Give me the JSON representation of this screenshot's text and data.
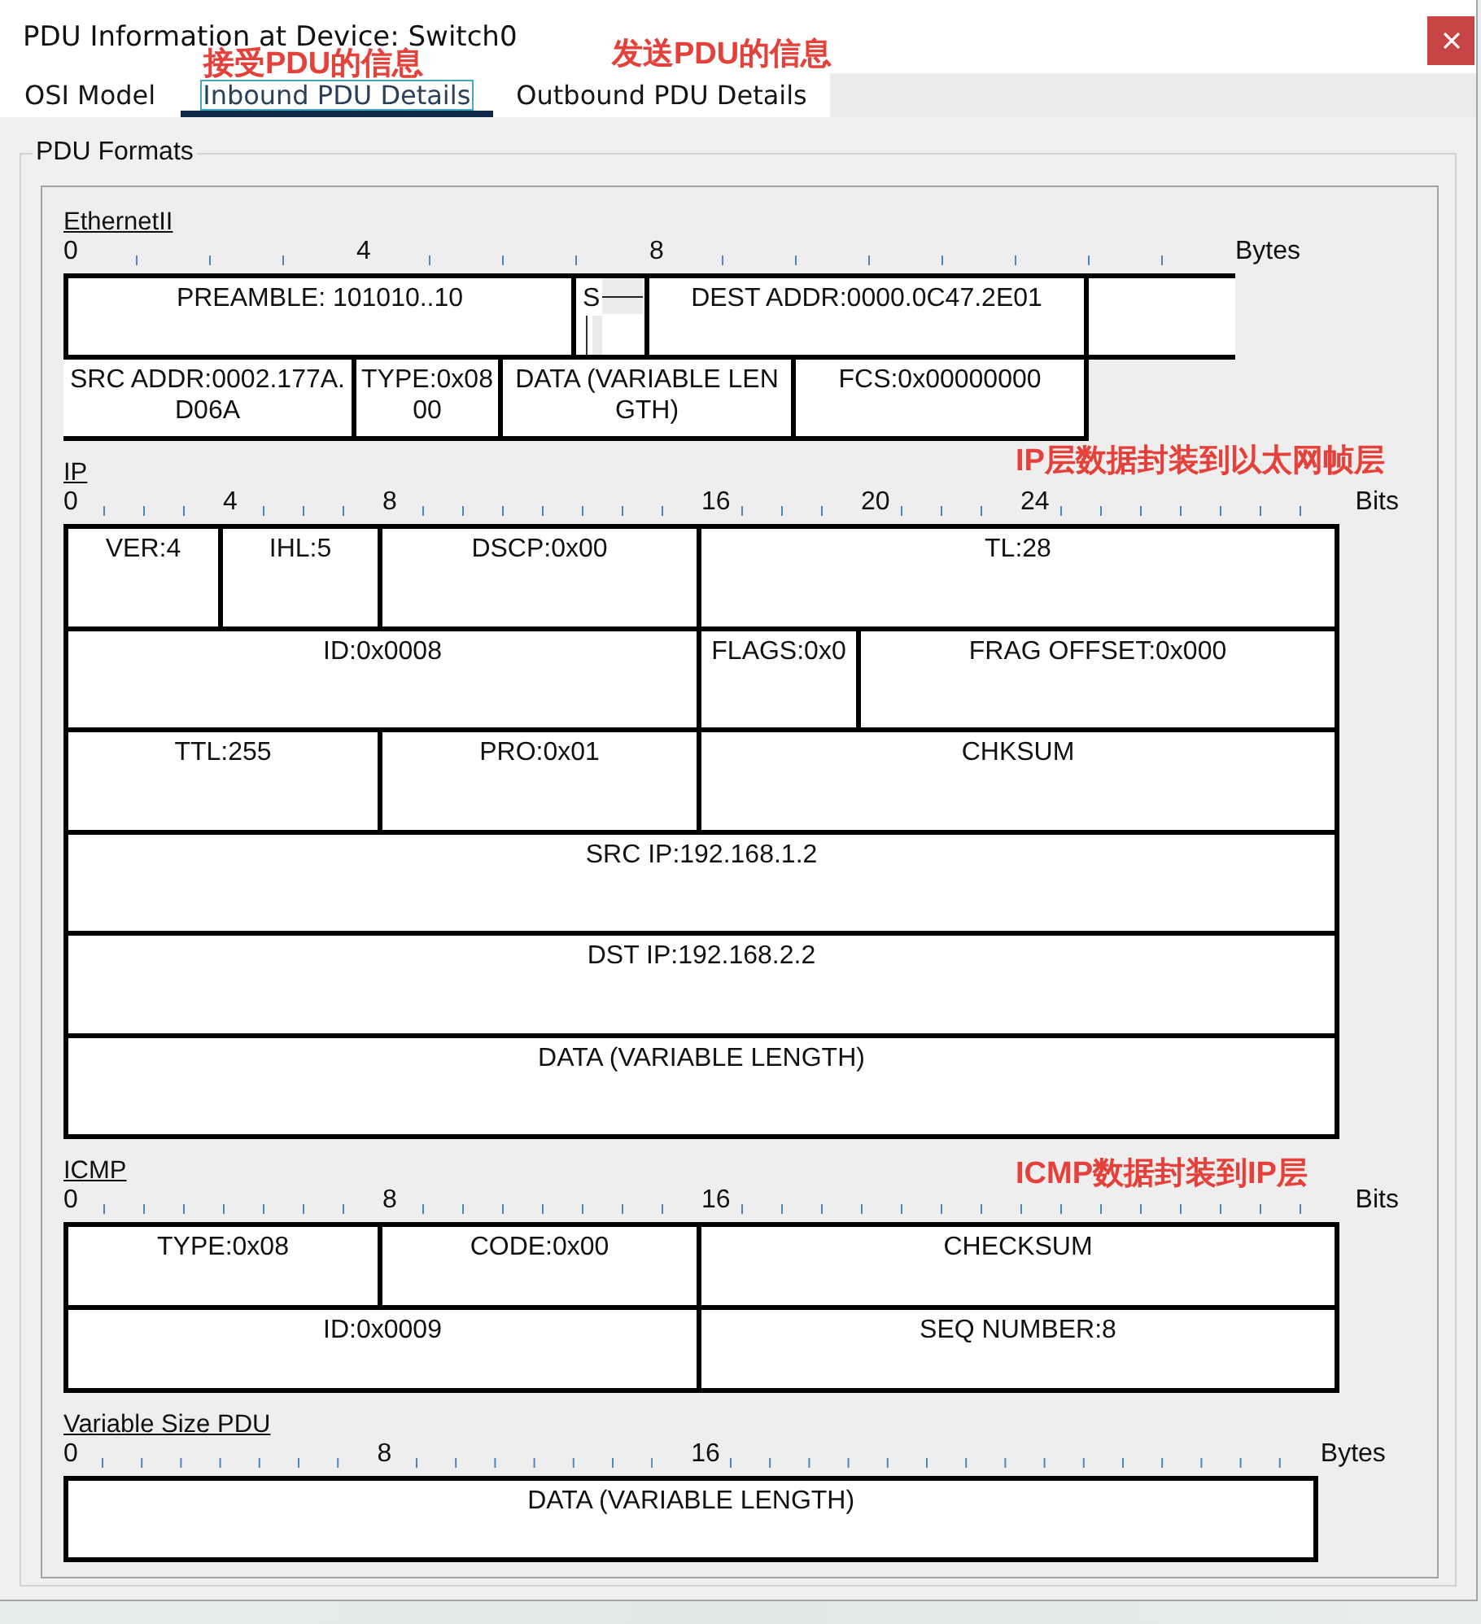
{
  "window": {
    "title": "PDU Information at Device: Switch0"
  },
  "tabs": [
    {
      "label": "OSI Model",
      "selected": false
    },
    {
      "label": "Inbound PDU Details",
      "selected": true
    },
    {
      "label": "Outbound PDU Details",
      "selected": false
    }
  ],
  "group": {
    "title": "PDU Formats"
  },
  "sections": [
    {
      "title": "EthernetII",
      "ruler": {
        "labels": [
          "0",
          "4",
          "8"
        ],
        "unit": "Bytes"
      },
      "fields": [
        {
          "kind": "text",
          "text": "PREAMBLE: 101010..10"
        },
        {
          "kind": "split",
          "text": "S"
        },
        {
          "kind": "text",
          "text": "DEST ADDR:0000.0C47.2E01"
        },
        {
          "kind": "blank"
        },
        {
          "kind": "text",
          "text": "SRC ADDR:0002.177A.\nD06A"
        },
        {
          "kind": "text",
          "text": "TYPE:0x08\n00"
        },
        {
          "kind": "text",
          "text": "DATA (VARIABLE LEN\nGTH)"
        },
        {
          "kind": "text",
          "text": "FCS:0x00000000"
        }
      ]
    },
    {
      "title": "IP",
      "ruler": {
        "labels": [
          "0",
          "4",
          "8",
          "16",
          "20",
          "24"
        ],
        "unit": "Bits"
      },
      "fields": [
        {
          "kind": "text",
          "text": "VER:4"
        },
        {
          "kind": "text",
          "text": "IHL:5"
        },
        {
          "kind": "text",
          "text": "DSCP:0x00"
        },
        {
          "kind": "text",
          "text": "TL:28"
        },
        {
          "kind": "text",
          "text": "ID:0x0008"
        },
        {
          "kind": "text",
          "text": "FLAGS:0x0"
        },
        {
          "kind": "text",
          "text": "FRAG OFFSET:0x000"
        },
        {
          "kind": "text",
          "text": "TTL:255"
        },
        {
          "kind": "text",
          "text": "PRO:0x01"
        },
        {
          "kind": "text",
          "text": "CHKSUM"
        },
        {
          "kind": "text",
          "text": "SRC IP:192.168.1.2"
        },
        {
          "kind": "text",
          "text": "DST IP:192.168.2.2"
        },
        {
          "kind": "text",
          "text": "DATA (VARIABLE LENGTH)"
        }
      ]
    },
    {
      "title": "ICMP",
      "ruler": {
        "labels": [
          "0",
          "8",
          "16"
        ],
        "unit": "Bits"
      },
      "fields": [
        {
          "kind": "text",
          "text": "TYPE:0x08"
        },
        {
          "kind": "text",
          "text": "CODE:0x00"
        },
        {
          "kind": "text",
          "text": "CHECKSUM"
        },
        {
          "kind": "text",
          "text": "ID:0x0009"
        },
        {
          "kind": "text",
          "text": "SEQ NUMBER:8"
        }
      ]
    },
    {
      "title": "Variable Size PDU",
      "ruler": {
        "labels": [
          "0",
          "8",
          "16"
        ],
        "unit": "Bytes"
      },
      "fields": [
        {
          "kind": "text",
          "text": "DATA (VARIABLE LENGTH)"
        }
      ]
    }
  ],
  "annotations": [
    {
      "text": "接受PDU的信息"
    },
    {
      "text": "发送PDU的信息"
    },
    {
      "text": "IP层数据封装到以太网帧层"
    },
    {
      "text": "ICMP数据封装到IP层"
    }
  ]
}
